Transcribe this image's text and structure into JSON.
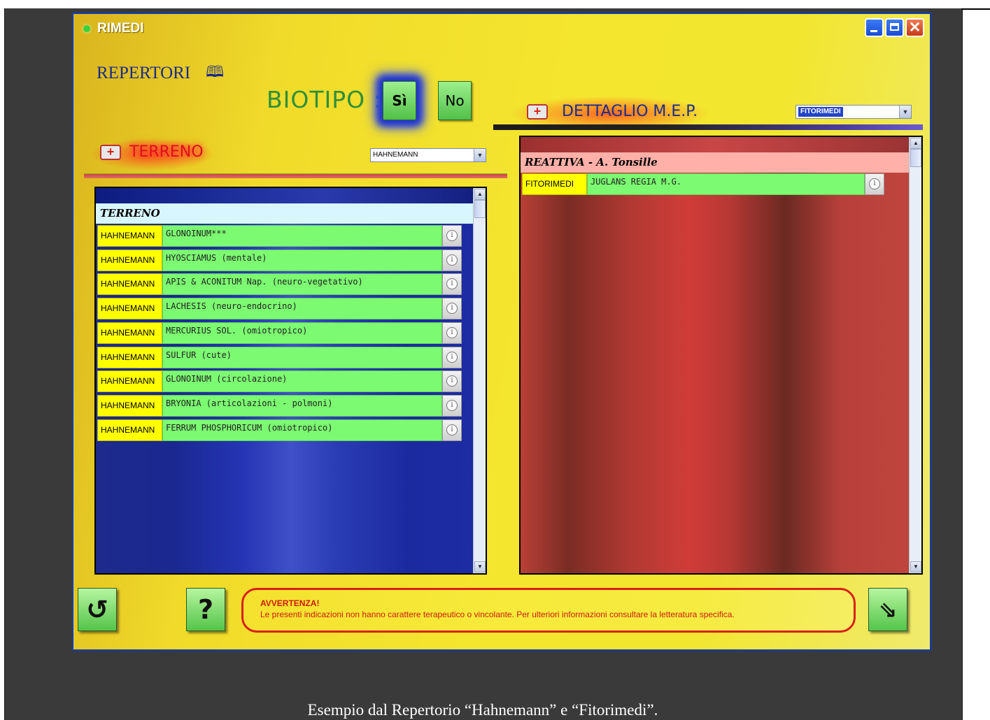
{
  "window": {
    "title": "RIMEDI",
    "minimize_icon": "minimize-icon",
    "maximize_icon": "maximize-icon",
    "close_icon": "close-icon"
  },
  "repertori": {
    "label": "REPERTORI",
    "icon": "book-icon"
  },
  "biotipo": {
    "label": "BIOTIPO :",
    "yes_label": "Sì",
    "no_label": "No",
    "selected": "Sì"
  },
  "terreno": {
    "title": "TERRENO",
    "icon": "first-aid-kit-icon",
    "select_value": "HAHNEMANN",
    "group_label": "TERRENO",
    "rows": [
      {
        "source": "HAHNEMANN",
        "remedy": "GLONOINUM***"
      },
      {
        "source": "HAHNEMANN",
        "remedy": "HYOSCIAMUS (mentale)"
      },
      {
        "source": "HAHNEMANN",
        "remedy": "APIS & ACONITUM Nap. (neuro-vegetativo)"
      },
      {
        "source": "HAHNEMANN",
        "remedy": "LACHESIS (neuro-endocrino)"
      },
      {
        "source": "HAHNEMANN",
        "remedy": "MERCURIUS SOL. (omiotropico)"
      },
      {
        "source": "HAHNEMANN",
        "remedy": "SULFUR (cute)"
      },
      {
        "source": "HAHNEMANN",
        "remedy": "GLONOINUM (circolazione)"
      },
      {
        "source": "HAHNEMANN",
        "remedy": "BRYONIA (articolazioni - polmoni)"
      },
      {
        "source": "HAHNEMANN",
        "remedy": "FERRUM PHOSPHORICUM (omiotropico)"
      }
    ]
  },
  "dettaglio": {
    "title": "DETTAGLIO M.E.P.",
    "icon": "first-aid-kit-icon",
    "select_value": "FITORIMEDI",
    "group_label": "REATTIVA - A. Tonsille",
    "rows": [
      {
        "source": "FITORIMEDI",
        "remedy": "JUGLANS REGIA M.G."
      }
    ]
  },
  "footer": {
    "reset_icon": "refresh-icon",
    "help_label": "?",
    "exit_icon": "exit-arrow-icon",
    "warning_title": "AVVERTENZA!",
    "warning_text": "Le presenti indicazioni non hanno carattere terapeutico o vincolante. Per ulteriori informazioni consultare la letteratura  specifica."
  },
  "caption": "Esempio dal Repertorio “Hahnemann” e “Fitorimedi”.",
  "colors": {
    "window_border": "#0a3dbb",
    "remedy_row": "#7cfa72",
    "source_cell": "#ffff00",
    "warning_red": "#d8201a"
  }
}
